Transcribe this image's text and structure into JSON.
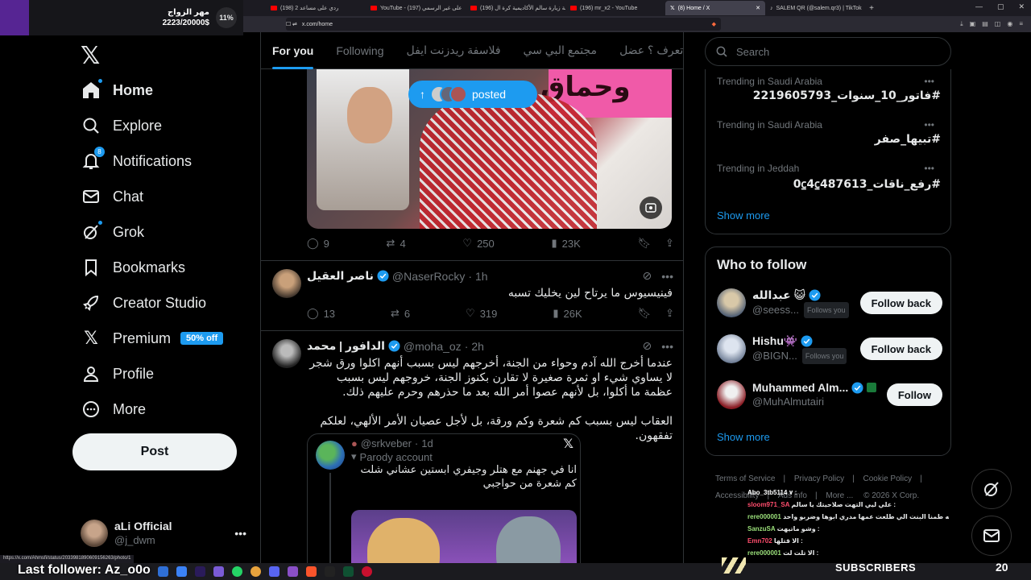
{
  "browser": {
    "tabs": [
      {
        "title": "(198) ردي على مساعد 2",
        "yt": true,
        "active": false
      },
      {
        "title": "YouTube - (197) على غير الرسمي",
        "yt": true,
        "active": false
      },
      {
        "title": "(196) قصة زيارة سالم الأكاديمية كرة ال",
        "yt": true,
        "active": false
      },
      {
        "title": "(196) mr_x2 - YouTube",
        "yt": true,
        "active": false
      },
      {
        "title": "(8) Home / X",
        "yt": false,
        "active": true
      },
      {
        "title": "SALEM QR (@salem.qr3) | TikTok",
        "yt": false,
        "active": false
      }
    ],
    "url": "x.com/home",
    "status_url": "https://x.com/Ahmsfi/status/2033981890609156263/photo/1"
  },
  "overlay": {
    "goal_label": "مهر الزواج",
    "goal_amount": "2223/20000$",
    "goal_percent": "11%",
    "last_follower": "Last follower: Az_o0o",
    "subscribers_label": "SUBSCRIBERS",
    "subscribers_count": "20",
    "chat": [
      {
        "user": "Abo_3tb5114",
        "msg": "٧ :",
        "cls": "u4"
      },
      {
        "user": "sloom971_SA",
        "msg": "علي ليي التهت صلاحيتك يا سالم :",
        "cls": "u2"
      },
      {
        "user": "rere000001",
        "msg": "ابيه طمنا البنت الي طلعت عمها مدري ابوها وضربو واحد :",
        "cls": "u3"
      },
      {
        "user": "SanzuSA",
        "msg": "وشو ماتيهت :",
        "cls": "u3"
      },
      {
        "user": "Emn702",
        "msg": "الا قتلها :",
        "cls": "u2"
      },
      {
        "user": "rere000001",
        "msg": "الا تلت لت :",
        "cls": "u3"
      }
    ]
  },
  "nav": {
    "items": [
      {
        "key": "home",
        "label": "Home",
        "bold": true
      },
      {
        "key": "explore",
        "label": "Explore"
      },
      {
        "key": "notifications",
        "label": "Notifications",
        "badge": "8"
      },
      {
        "key": "chat",
        "label": "Chat"
      },
      {
        "key": "grok",
        "label": "Grok"
      },
      {
        "key": "bookmarks",
        "label": "Bookmarks"
      },
      {
        "key": "creator-studio",
        "label": "Creator Studio"
      },
      {
        "key": "premium",
        "label": "Premium",
        "promo": "50% off"
      },
      {
        "key": "profile",
        "label": "Profile"
      },
      {
        "key": "more",
        "label": "More"
      }
    ],
    "post_label": "Post",
    "account": {
      "name": "aLi Official",
      "handle": "@j_dwm"
    }
  },
  "feed": {
    "tabs": [
      {
        "label": "For you",
        "active": true
      },
      {
        "label": "Following"
      },
      {
        "label": "فلاسفة ريدزنت ايفل"
      },
      {
        "label": "مجتمع البي سي"
      },
      {
        "label": "هنا راح تعرف ؟ عضل"
      }
    ],
    "posted_pill": "posted",
    "media_text": "وحماق",
    "tweet1_actions": {
      "replies": "9",
      "reposts": "4",
      "likes": "250",
      "views": "23K"
    },
    "tweet2": {
      "name": "ناصر العقيل",
      "handle": "@NaserRocky",
      "time": "1h",
      "text": "فينيسيوس ما يرتاح لين يخليك تسبه",
      "actions": {
        "replies": "13",
        "reposts": "6",
        "likes": "319",
        "views": "26K"
      }
    },
    "tweet3": {
      "name": "الدافور | محمد",
      "handle": "@moha_oz",
      "time": "2h",
      "text": "عندما أخرج الله آدم وحواء من الجنة، أخرجهم ليس بسبب أنهم اكلوا ورق شجر لا يساوي شيء او ثمرة صغيرة لا تقارن بكنوز الجنة، خروجهم ليس بسبب عظمة ما أكلوا، بل لأنهم عصوا أمر الله بعد ما حذرهم وحرم عليهم ذلك.",
      "text2": "العقاب ليس بسبب كم شعرة وكم ورقة، بل لأجل عصيان الأمر الألهي، لعلكم تفقهون.",
      "quote": {
        "handle": "@srkveber",
        "time": "1d",
        "label": "Parody account",
        "text": "انا في جهنم مع هتلر وجيفري ابستين عشاني شلت كم شعرة من حواجبي"
      }
    }
  },
  "right": {
    "search_placeholder": "Search",
    "trends": [
      {
        "context": "Trending in Saudi Arabia",
        "name": "#فاتور_10_سنوات_2219605793"
      },
      {
        "context": "Trending in Saudi Arabia",
        "name": "#تبيها_صفر"
      },
      {
        "context": "Trending in Jeddah",
        "name": "#رفع_ناقات_487613⃀4⃀0"
      }
    ],
    "show_more": "Show more",
    "wtf_title": "Who to follow",
    "wtf": [
      {
        "name": "عبدالله 😺",
        "handle": "@seess...",
        "follows_you": "Follows you",
        "button": "Follow back"
      },
      {
        "name": "Hishu👾",
        "handle": "@BIGN...",
        "follows_you": "Follows you",
        "button": "Follow back"
      },
      {
        "name": "Muhammed Alm...",
        "handle": "@MuhAlmutairi",
        "follows_you": "",
        "button": "Follow"
      }
    ],
    "footer": [
      "Terms of Service",
      "Privacy Policy",
      "Cookie Policy",
      "Accessibility",
      "Ads info",
      "More ...",
      "© 2026 X Corp."
    ]
  }
}
